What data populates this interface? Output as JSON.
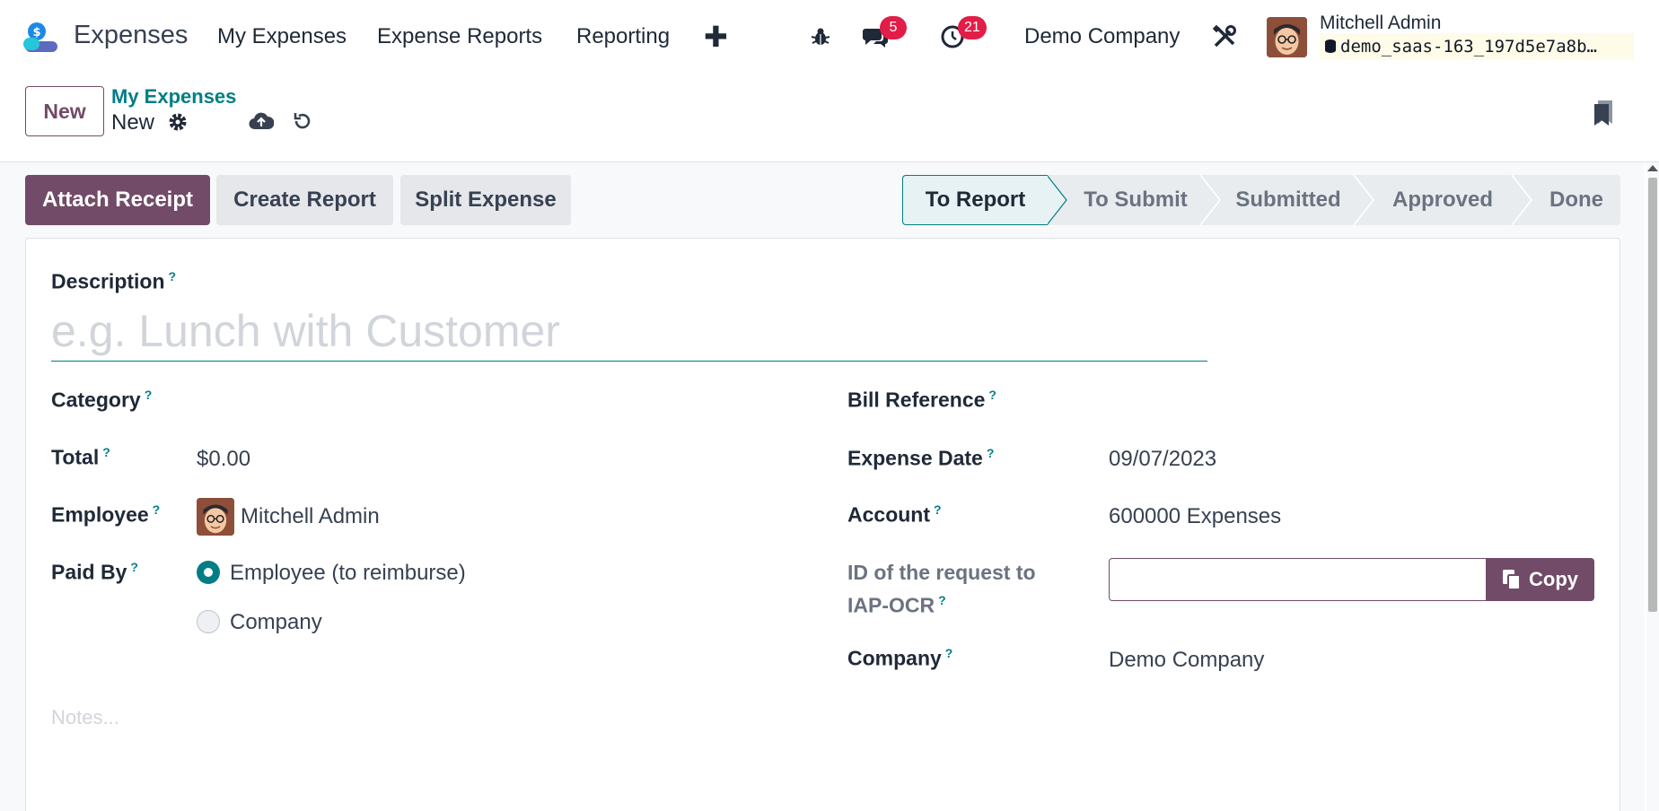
{
  "navbar": {
    "app_name": "Expenses",
    "menu": [
      "My Expenses",
      "Expense Reports",
      "Reporting"
    ],
    "add_menu_glyph": "✚",
    "messages_count": "5",
    "activities_count": "21",
    "company": "Demo Company",
    "user_name": "Mitchell Admin",
    "database": "demo_saas-163_197d5e7a8b…"
  },
  "control_panel": {
    "new_label": "New",
    "breadcrumb_parent": "My Expenses",
    "breadcrumb_current": "New"
  },
  "actions": {
    "attach_receipt": "Attach Receipt",
    "create_report": "Create Report",
    "split_expense": "Split Expense"
  },
  "status_stages": [
    "To Report",
    "To Submit",
    "Submitted",
    "Approved",
    "Done"
  ],
  "active_stage": "To Report",
  "form": {
    "description_label": "Description",
    "description_placeholder": "e.g. Lunch with Customer",
    "category_label": "Category",
    "total_label": "Total",
    "total_value": "$0.00",
    "employee_label": "Employee",
    "employee_value": "Mitchell Admin",
    "paid_by_label": "Paid By",
    "paid_by_options": [
      "Employee (to reimburse)",
      "Company"
    ],
    "paid_by_selected": "Employee (to reimburse)",
    "bill_reference_label": "Bill Reference",
    "expense_date_label": "Expense Date",
    "expense_date_value": "09/07/2023",
    "account_label": "Account",
    "account_value": "600000 Expenses",
    "ocr_label_line1": "ID of the request to",
    "ocr_label_line2": "IAP-OCR",
    "copy_label": "Copy",
    "company_label": "Company",
    "company_value": "Demo Company",
    "notes_placeholder": "Notes...",
    "help_mark": "?"
  },
  "colors": {
    "brand": "#714b67",
    "accent": "#017e84",
    "badge": "#e11d48"
  },
  "icons": [
    "expenses-app-icon",
    "bug-icon",
    "chat-icon",
    "clock-icon",
    "tools-icon",
    "gear-icon",
    "cloud-upload-icon",
    "discard-icon",
    "bookmark-icon",
    "copy-icon"
  ]
}
